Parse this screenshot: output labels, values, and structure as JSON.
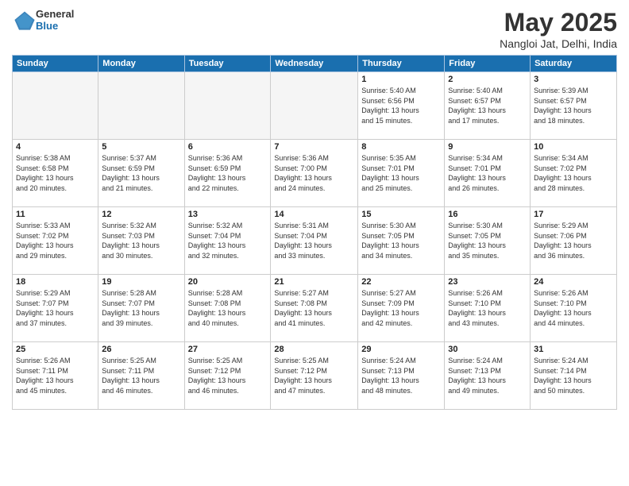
{
  "header": {
    "title": "May 2025",
    "location": "Nangloi Jat, Delhi, India",
    "logo_general": "General",
    "logo_blue": "Blue"
  },
  "weekdays": [
    "Sunday",
    "Monday",
    "Tuesday",
    "Wednesday",
    "Thursday",
    "Friday",
    "Saturday"
  ],
  "weeks": [
    [
      {
        "day": "",
        "info": ""
      },
      {
        "day": "",
        "info": ""
      },
      {
        "day": "",
        "info": ""
      },
      {
        "day": "",
        "info": ""
      },
      {
        "day": "1",
        "info": "Sunrise: 5:40 AM\nSunset: 6:56 PM\nDaylight: 13 hours\nand 15 minutes."
      },
      {
        "day": "2",
        "info": "Sunrise: 5:40 AM\nSunset: 6:57 PM\nDaylight: 13 hours\nand 17 minutes."
      },
      {
        "day": "3",
        "info": "Sunrise: 5:39 AM\nSunset: 6:57 PM\nDaylight: 13 hours\nand 18 minutes."
      }
    ],
    [
      {
        "day": "4",
        "info": "Sunrise: 5:38 AM\nSunset: 6:58 PM\nDaylight: 13 hours\nand 20 minutes."
      },
      {
        "day": "5",
        "info": "Sunrise: 5:37 AM\nSunset: 6:59 PM\nDaylight: 13 hours\nand 21 minutes."
      },
      {
        "day": "6",
        "info": "Sunrise: 5:36 AM\nSunset: 6:59 PM\nDaylight: 13 hours\nand 22 minutes."
      },
      {
        "day": "7",
        "info": "Sunrise: 5:36 AM\nSunset: 7:00 PM\nDaylight: 13 hours\nand 24 minutes."
      },
      {
        "day": "8",
        "info": "Sunrise: 5:35 AM\nSunset: 7:01 PM\nDaylight: 13 hours\nand 25 minutes."
      },
      {
        "day": "9",
        "info": "Sunrise: 5:34 AM\nSunset: 7:01 PM\nDaylight: 13 hours\nand 26 minutes."
      },
      {
        "day": "10",
        "info": "Sunrise: 5:34 AM\nSunset: 7:02 PM\nDaylight: 13 hours\nand 28 minutes."
      }
    ],
    [
      {
        "day": "11",
        "info": "Sunrise: 5:33 AM\nSunset: 7:02 PM\nDaylight: 13 hours\nand 29 minutes."
      },
      {
        "day": "12",
        "info": "Sunrise: 5:32 AM\nSunset: 7:03 PM\nDaylight: 13 hours\nand 30 minutes."
      },
      {
        "day": "13",
        "info": "Sunrise: 5:32 AM\nSunset: 7:04 PM\nDaylight: 13 hours\nand 32 minutes."
      },
      {
        "day": "14",
        "info": "Sunrise: 5:31 AM\nSunset: 7:04 PM\nDaylight: 13 hours\nand 33 minutes."
      },
      {
        "day": "15",
        "info": "Sunrise: 5:30 AM\nSunset: 7:05 PM\nDaylight: 13 hours\nand 34 minutes."
      },
      {
        "day": "16",
        "info": "Sunrise: 5:30 AM\nSunset: 7:05 PM\nDaylight: 13 hours\nand 35 minutes."
      },
      {
        "day": "17",
        "info": "Sunrise: 5:29 AM\nSunset: 7:06 PM\nDaylight: 13 hours\nand 36 minutes."
      }
    ],
    [
      {
        "day": "18",
        "info": "Sunrise: 5:29 AM\nSunset: 7:07 PM\nDaylight: 13 hours\nand 37 minutes."
      },
      {
        "day": "19",
        "info": "Sunrise: 5:28 AM\nSunset: 7:07 PM\nDaylight: 13 hours\nand 39 minutes."
      },
      {
        "day": "20",
        "info": "Sunrise: 5:28 AM\nSunset: 7:08 PM\nDaylight: 13 hours\nand 40 minutes."
      },
      {
        "day": "21",
        "info": "Sunrise: 5:27 AM\nSunset: 7:08 PM\nDaylight: 13 hours\nand 41 minutes."
      },
      {
        "day": "22",
        "info": "Sunrise: 5:27 AM\nSunset: 7:09 PM\nDaylight: 13 hours\nand 42 minutes."
      },
      {
        "day": "23",
        "info": "Sunrise: 5:26 AM\nSunset: 7:10 PM\nDaylight: 13 hours\nand 43 minutes."
      },
      {
        "day": "24",
        "info": "Sunrise: 5:26 AM\nSunset: 7:10 PM\nDaylight: 13 hours\nand 44 minutes."
      }
    ],
    [
      {
        "day": "25",
        "info": "Sunrise: 5:26 AM\nSunset: 7:11 PM\nDaylight: 13 hours\nand 45 minutes."
      },
      {
        "day": "26",
        "info": "Sunrise: 5:25 AM\nSunset: 7:11 PM\nDaylight: 13 hours\nand 46 minutes."
      },
      {
        "day": "27",
        "info": "Sunrise: 5:25 AM\nSunset: 7:12 PM\nDaylight: 13 hours\nand 46 minutes."
      },
      {
        "day": "28",
        "info": "Sunrise: 5:25 AM\nSunset: 7:12 PM\nDaylight: 13 hours\nand 47 minutes."
      },
      {
        "day": "29",
        "info": "Sunrise: 5:24 AM\nSunset: 7:13 PM\nDaylight: 13 hours\nand 48 minutes."
      },
      {
        "day": "30",
        "info": "Sunrise: 5:24 AM\nSunset: 7:13 PM\nDaylight: 13 hours\nand 49 minutes."
      },
      {
        "day": "31",
        "info": "Sunrise: 5:24 AM\nSunset: 7:14 PM\nDaylight: 13 hours\nand 50 minutes."
      }
    ]
  ]
}
